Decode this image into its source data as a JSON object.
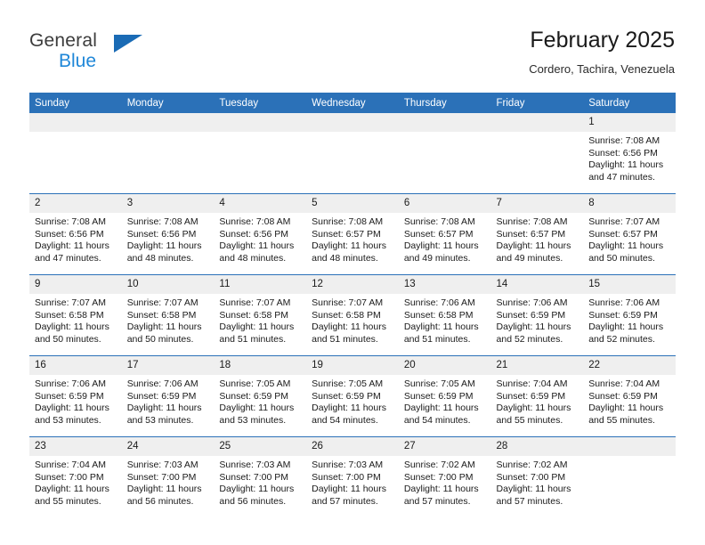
{
  "brand": {
    "name_top": "General",
    "name_bottom": "Blue",
    "color_top": "#3c3c3c",
    "color_bottom": "#1f87d8",
    "triangle_color": "#1a6bb5"
  },
  "header": {
    "title": "February 2025",
    "subtitle": "Cordero, Tachira, Venezuela"
  },
  "theme": {
    "header_bg": "#2b71b8",
    "header_text": "#ffffff",
    "daynum_bg": "#efefef",
    "row_border": "#2b71b8"
  },
  "weekdays": [
    "Sunday",
    "Monday",
    "Tuesday",
    "Wednesday",
    "Thursday",
    "Friday",
    "Saturday"
  ],
  "labels": {
    "sunrise_prefix": "Sunrise: ",
    "sunset_prefix": "Sunset: ",
    "daylight_prefix": "Daylight: "
  },
  "weeks": [
    [
      {
        "day": "",
        "empty": true
      },
      {
        "day": "",
        "empty": true
      },
      {
        "day": "",
        "empty": true
      },
      {
        "day": "",
        "empty": true
      },
      {
        "day": "",
        "empty": true
      },
      {
        "day": "",
        "empty": true
      },
      {
        "day": "1",
        "sunrise": "Sunrise: 7:08 AM",
        "sunset": "Sunset: 6:56 PM",
        "daylight": "Daylight: 11 hours and 47 minutes."
      }
    ],
    [
      {
        "day": "2",
        "sunrise": "Sunrise: 7:08 AM",
        "sunset": "Sunset: 6:56 PM",
        "daylight": "Daylight: 11 hours and 47 minutes."
      },
      {
        "day": "3",
        "sunrise": "Sunrise: 7:08 AM",
        "sunset": "Sunset: 6:56 PM",
        "daylight": "Daylight: 11 hours and 48 minutes."
      },
      {
        "day": "4",
        "sunrise": "Sunrise: 7:08 AM",
        "sunset": "Sunset: 6:56 PM",
        "daylight": "Daylight: 11 hours and 48 minutes."
      },
      {
        "day": "5",
        "sunrise": "Sunrise: 7:08 AM",
        "sunset": "Sunset: 6:57 PM",
        "daylight": "Daylight: 11 hours and 48 minutes."
      },
      {
        "day": "6",
        "sunrise": "Sunrise: 7:08 AM",
        "sunset": "Sunset: 6:57 PM",
        "daylight": "Daylight: 11 hours and 49 minutes."
      },
      {
        "day": "7",
        "sunrise": "Sunrise: 7:08 AM",
        "sunset": "Sunset: 6:57 PM",
        "daylight": "Daylight: 11 hours and 49 minutes."
      },
      {
        "day": "8",
        "sunrise": "Sunrise: 7:07 AM",
        "sunset": "Sunset: 6:57 PM",
        "daylight": "Daylight: 11 hours and 50 minutes."
      }
    ],
    [
      {
        "day": "9",
        "sunrise": "Sunrise: 7:07 AM",
        "sunset": "Sunset: 6:58 PM",
        "daylight": "Daylight: 11 hours and 50 minutes."
      },
      {
        "day": "10",
        "sunrise": "Sunrise: 7:07 AM",
        "sunset": "Sunset: 6:58 PM",
        "daylight": "Daylight: 11 hours and 50 minutes."
      },
      {
        "day": "11",
        "sunrise": "Sunrise: 7:07 AM",
        "sunset": "Sunset: 6:58 PM",
        "daylight": "Daylight: 11 hours and 51 minutes."
      },
      {
        "day": "12",
        "sunrise": "Sunrise: 7:07 AM",
        "sunset": "Sunset: 6:58 PM",
        "daylight": "Daylight: 11 hours and 51 minutes."
      },
      {
        "day": "13",
        "sunrise": "Sunrise: 7:06 AM",
        "sunset": "Sunset: 6:58 PM",
        "daylight": "Daylight: 11 hours and 51 minutes."
      },
      {
        "day": "14",
        "sunrise": "Sunrise: 7:06 AM",
        "sunset": "Sunset: 6:59 PM",
        "daylight": "Daylight: 11 hours and 52 minutes."
      },
      {
        "day": "15",
        "sunrise": "Sunrise: 7:06 AM",
        "sunset": "Sunset: 6:59 PM",
        "daylight": "Daylight: 11 hours and 52 minutes."
      }
    ],
    [
      {
        "day": "16",
        "sunrise": "Sunrise: 7:06 AM",
        "sunset": "Sunset: 6:59 PM",
        "daylight": "Daylight: 11 hours and 53 minutes."
      },
      {
        "day": "17",
        "sunrise": "Sunrise: 7:06 AM",
        "sunset": "Sunset: 6:59 PM",
        "daylight": "Daylight: 11 hours and 53 minutes."
      },
      {
        "day": "18",
        "sunrise": "Sunrise: 7:05 AM",
        "sunset": "Sunset: 6:59 PM",
        "daylight": "Daylight: 11 hours and 53 minutes."
      },
      {
        "day": "19",
        "sunrise": "Sunrise: 7:05 AM",
        "sunset": "Sunset: 6:59 PM",
        "daylight": "Daylight: 11 hours and 54 minutes."
      },
      {
        "day": "20",
        "sunrise": "Sunrise: 7:05 AM",
        "sunset": "Sunset: 6:59 PM",
        "daylight": "Daylight: 11 hours and 54 minutes."
      },
      {
        "day": "21",
        "sunrise": "Sunrise: 7:04 AM",
        "sunset": "Sunset: 6:59 PM",
        "daylight": "Daylight: 11 hours and 55 minutes."
      },
      {
        "day": "22",
        "sunrise": "Sunrise: 7:04 AM",
        "sunset": "Sunset: 6:59 PM",
        "daylight": "Daylight: 11 hours and 55 minutes."
      }
    ],
    [
      {
        "day": "23",
        "sunrise": "Sunrise: 7:04 AM",
        "sunset": "Sunset: 7:00 PM",
        "daylight": "Daylight: 11 hours and 55 minutes."
      },
      {
        "day": "24",
        "sunrise": "Sunrise: 7:03 AM",
        "sunset": "Sunset: 7:00 PM",
        "daylight": "Daylight: 11 hours and 56 minutes."
      },
      {
        "day": "25",
        "sunrise": "Sunrise: 7:03 AM",
        "sunset": "Sunset: 7:00 PM",
        "daylight": "Daylight: 11 hours and 56 minutes."
      },
      {
        "day": "26",
        "sunrise": "Sunrise: 7:03 AM",
        "sunset": "Sunset: 7:00 PM",
        "daylight": "Daylight: 11 hours and 57 minutes."
      },
      {
        "day": "27",
        "sunrise": "Sunrise: 7:02 AM",
        "sunset": "Sunset: 7:00 PM",
        "daylight": "Daylight: 11 hours and 57 minutes."
      },
      {
        "day": "28",
        "sunrise": "Sunrise: 7:02 AM",
        "sunset": "Sunset: 7:00 PM",
        "daylight": "Daylight: 11 hours and 57 minutes."
      },
      {
        "day": "",
        "empty": true
      }
    ]
  ]
}
